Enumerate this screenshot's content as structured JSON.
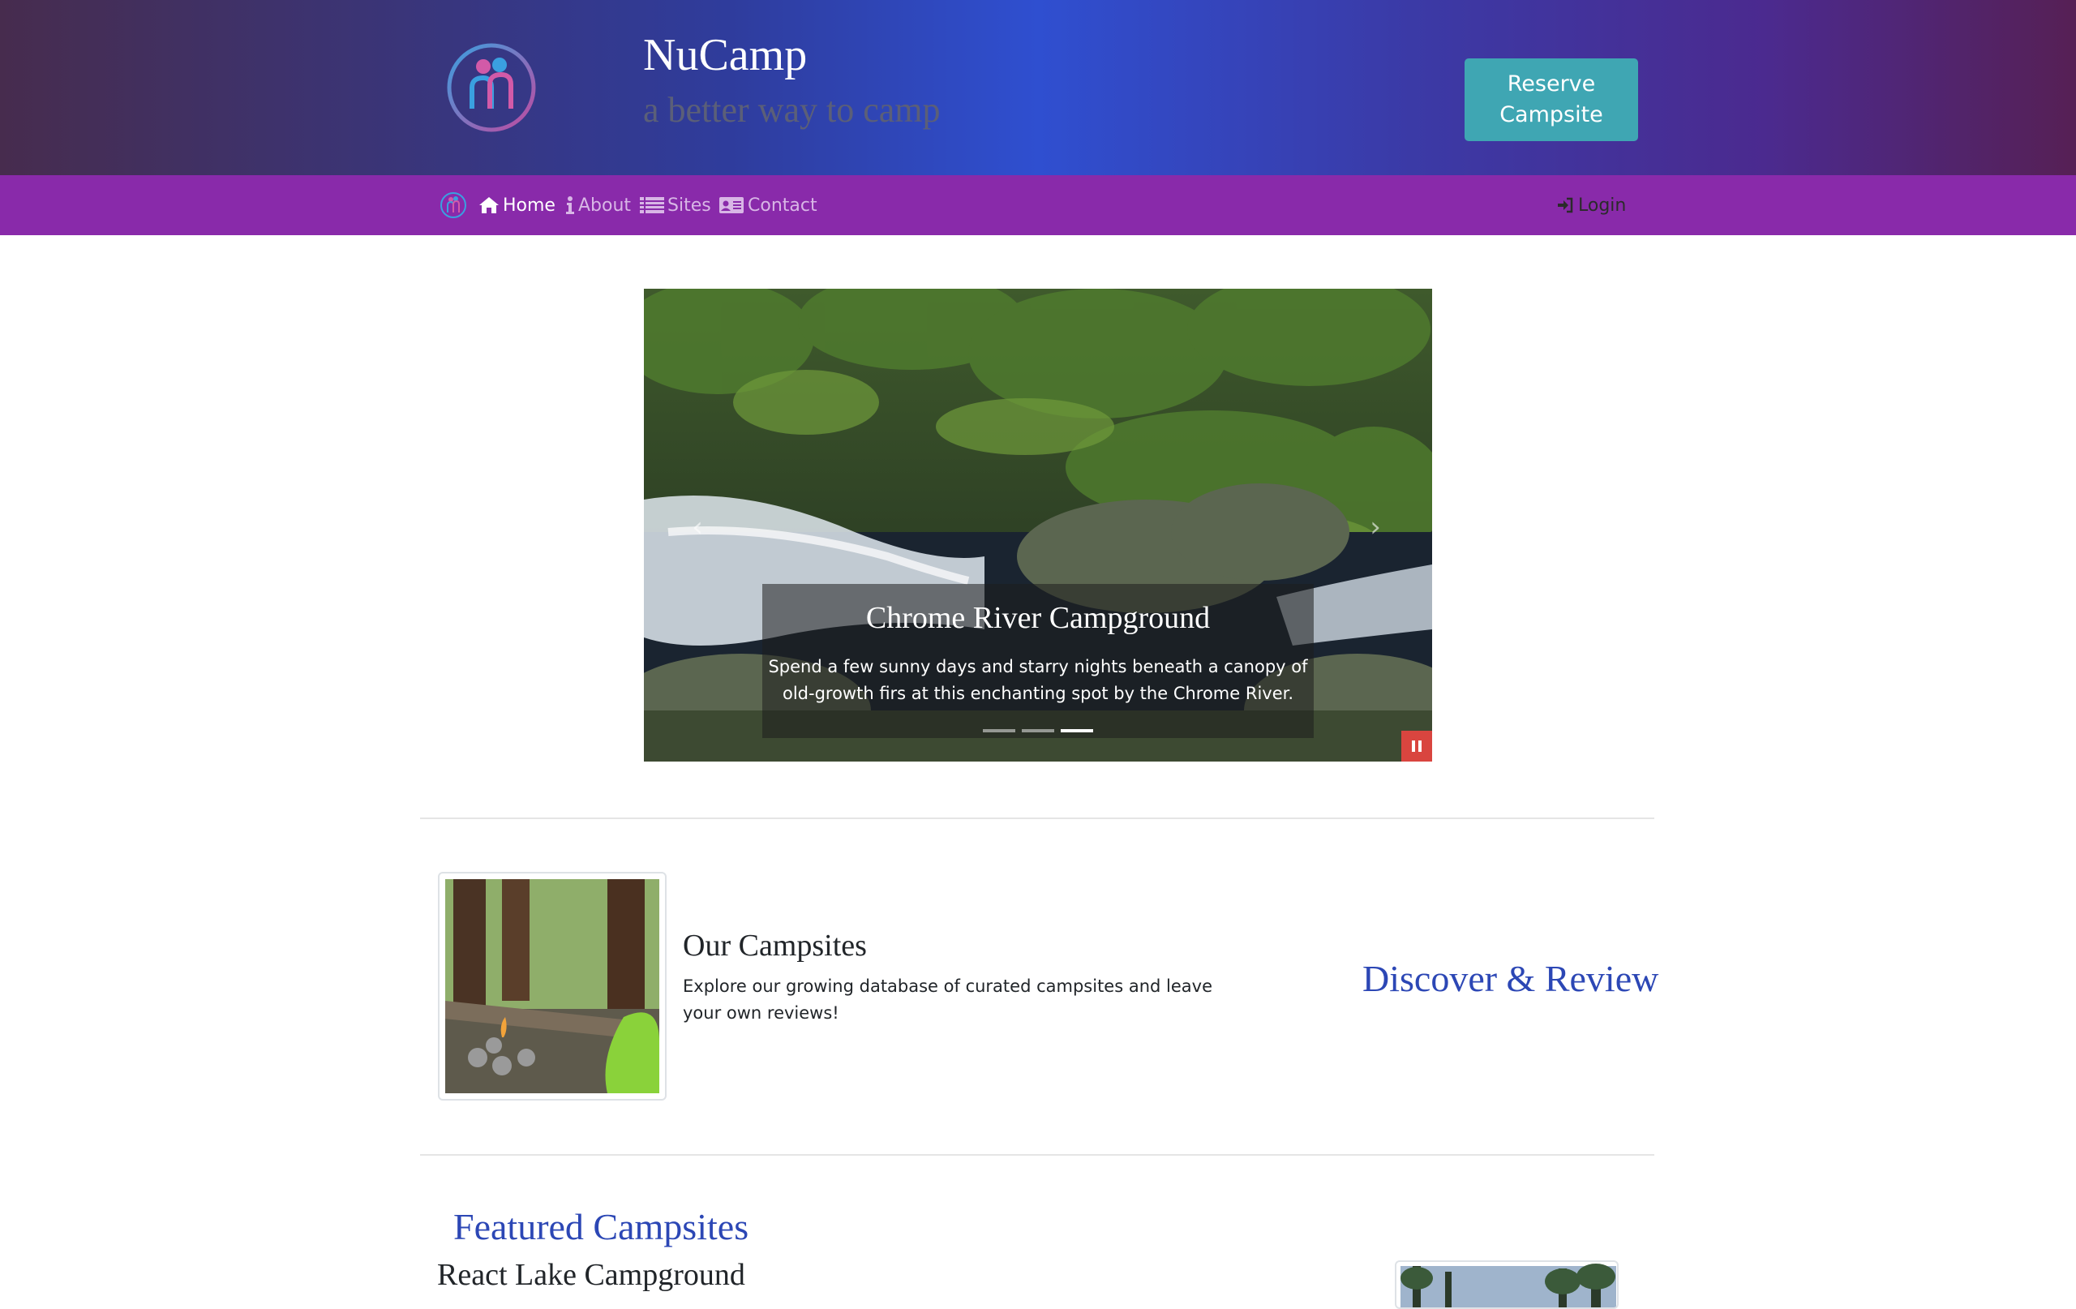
{
  "header": {
    "title": "NuCamp",
    "tagline": "a better way to camp",
    "reserve_button": "Reserve Campsite",
    "logo_icon": "nucamp-logo-icon"
  },
  "nav": {
    "items": [
      {
        "label": "Home",
        "icon": "home-icon",
        "active": true
      },
      {
        "label": "About",
        "icon": "info-icon",
        "active": false
      },
      {
        "label": "Sites",
        "icon": "list-icon",
        "active": false
      },
      {
        "label": "Contact",
        "icon": "address-card-icon",
        "active": false
      }
    ],
    "login": "Login",
    "login_icon": "sign-in-icon"
  },
  "carousel": {
    "slides_count": 3,
    "active_slide_index": 2,
    "caption_title": "Chrome River Campground",
    "caption_text": "Spend a few sunny days and starry nights beneath a canopy of old-growth firs at this enchanting spot by the Chrome River.",
    "prev_icon": "chevron-left-icon",
    "next_icon": "chevron-right-icon",
    "pause_icon": "pause-icon"
  },
  "campsites": {
    "heading": "Our Campsites",
    "text": "Explore our growing database of curated campsites and leave your own reviews!",
    "side_heading": "Discover & Review"
  },
  "featured": {
    "title": "Featured Campsites",
    "campground": "React Lake Campground"
  },
  "colors": {
    "navbar": "#892aaa",
    "reserve_button": "#3fa6b3",
    "accent_blue": "#2c47b5",
    "pause_button": "#d9453f"
  }
}
